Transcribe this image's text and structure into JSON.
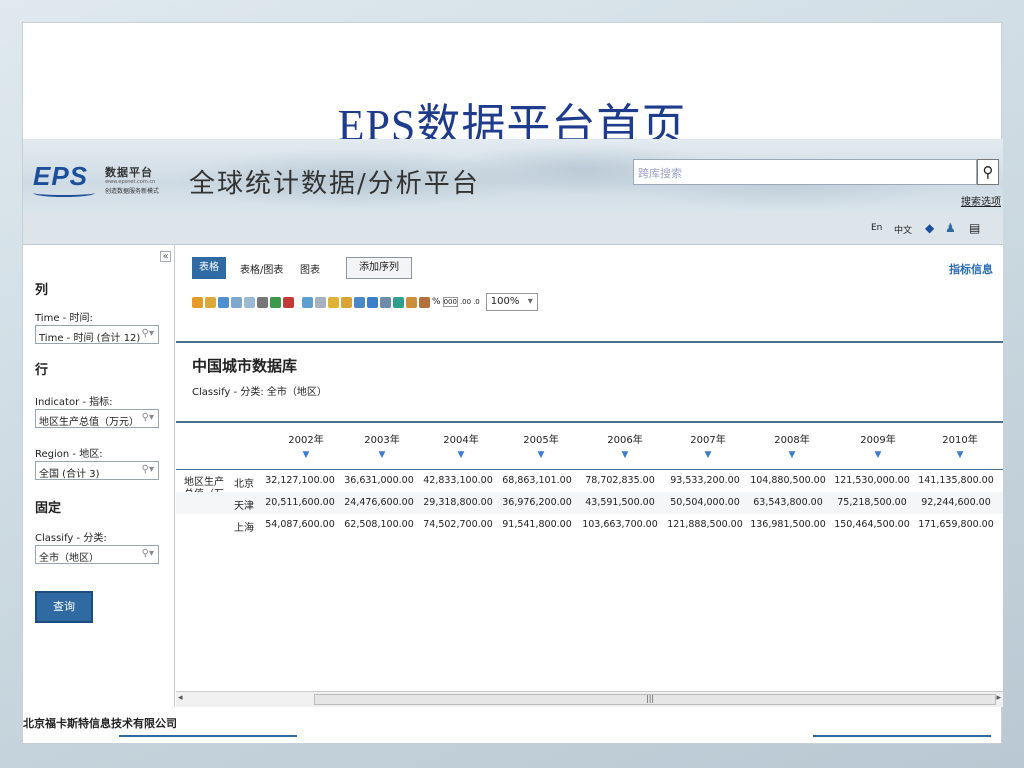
{
  "slide_title": "EPS数据平台首页",
  "header": {
    "logo_text": "EPS",
    "logo_name": "数据平台",
    "logo_url": "www.epsnet.com.cn",
    "logo_slogan": "创造数据服务新模式",
    "logo_sub": "????",
    "platform_title": "全球统计数据/分析平台",
    "search_placeholder": "跨库搜索",
    "search_options": "搜索选项"
  },
  "lang": {
    "en": "En",
    "zh": "中文"
  },
  "left_panel": {
    "col_section": "列",
    "time_label": "Time - 时间:",
    "time_value": "Time - 时间 (合计 12)",
    "row_section": "行",
    "indicator_label": "Indicator - 指标:",
    "indicator_value": "地区生产总值（万元）",
    "region_label": "Region - 地区:",
    "region_value": "全国 (合计 3)",
    "fixed_section": "固定",
    "classify_label": "Classify - 分类:",
    "classify_value": "全市（地区）",
    "query_button": "查询"
  },
  "tabs": {
    "table": "表格",
    "table_chart": "表格/图表",
    "chart": "图表",
    "add_series": "添加序列",
    "indicator_info": "指标信息"
  },
  "zoom": "100%",
  "database": {
    "title": "中国城市数据库",
    "classify": "Classify - 分类: 全市（地区）"
  },
  "table": {
    "row_label": "地区生产总值（万元）",
    "years": [
      "2002年",
      "2003年",
      "2004年",
      "2005年",
      "2006年",
      "2007年",
      "2008年",
      "2009年",
      "2010年"
    ],
    "rows": [
      {
        "region": "北京",
        "values": [
          "32,127,100.00",
          "36,631,000.00",
          "42,833,100.00",
          "68,863,101.00",
          "78,702,835.00",
          "93,533,200.00",
          "104,880,500.00",
          "121,530,000.00",
          "141,135,800.00"
        ]
      },
      {
        "region": "天津",
        "values": [
          "20,511,600.00",
          "24,476,600.00",
          "29,318,800.00",
          "36,976,200.00",
          "43,591,500.00",
          "50,504,000.00",
          "63,543,800.00",
          "75,218,500.00",
          "92,244,600.00"
        ]
      },
      {
        "region": "上海",
        "values": [
          "54,087,600.00",
          "62,508,100.00",
          "74,502,700.00",
          "91,541,800.00",
          "103,663,700.00",
          "121,888,500.00",
          "136,981,500.00",
          "150,464,500.00",
          "171,659,800.00"
        ]
      }
    ]
  },
  "footer": "北京福卡斯特信息技术有限公司",
  "colors": {
    "title": "#1f3c8c",
    "accent": "#2f6aa3",
    "rule": "#4c6f8d"
  }
}
